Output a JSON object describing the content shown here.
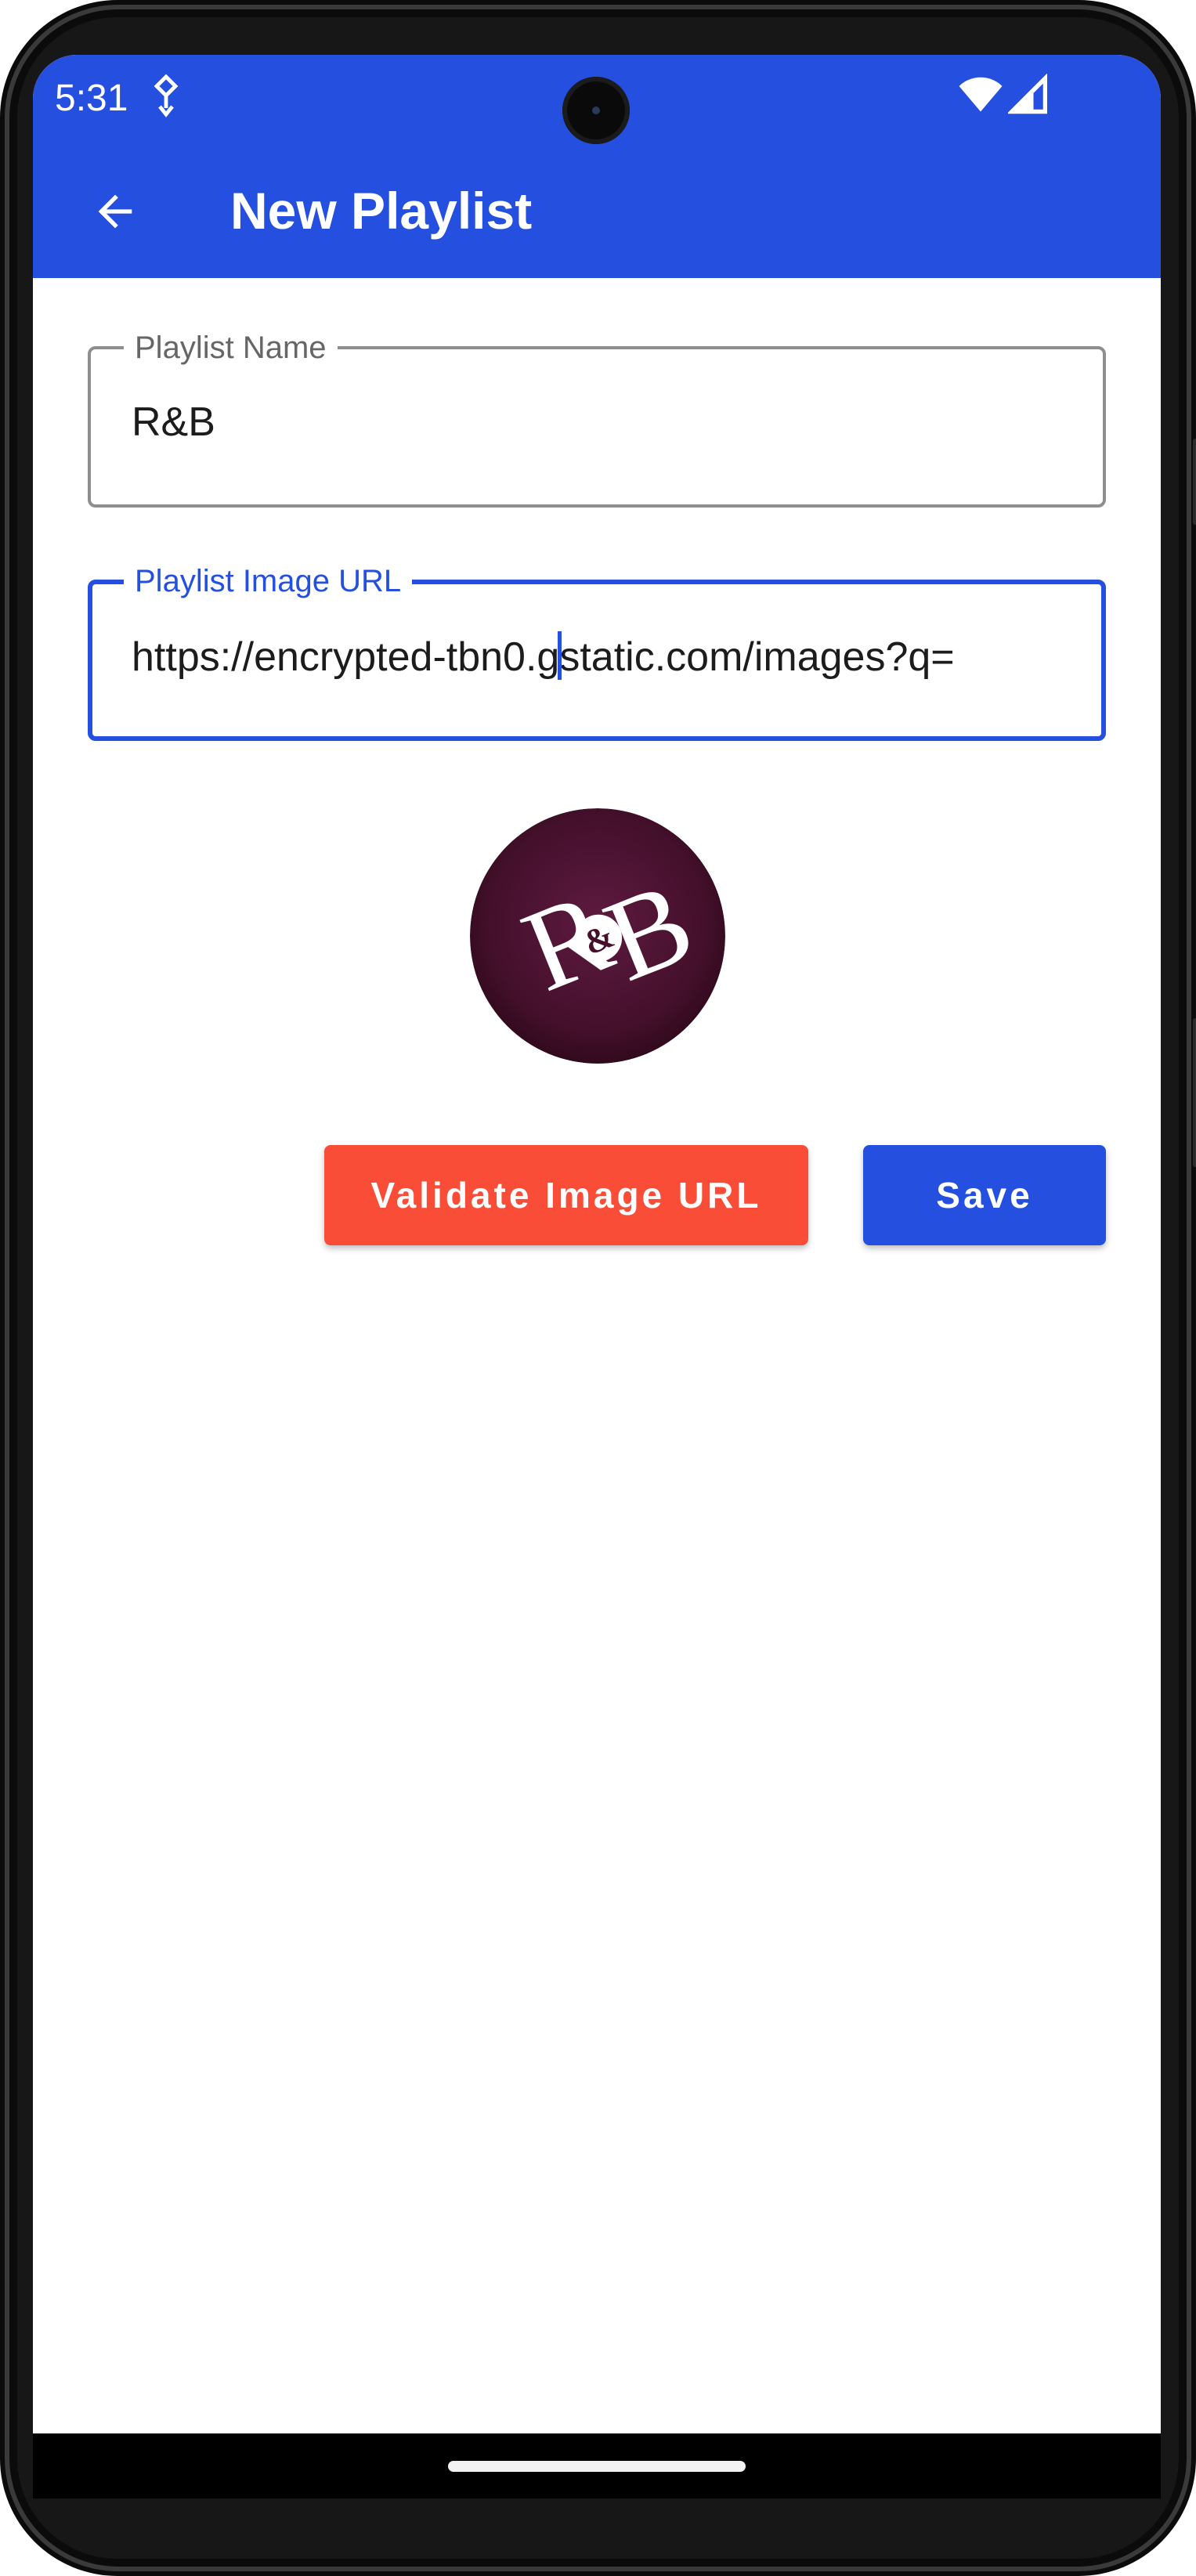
{
  "status_bar": {
    "time": "5:31",
    "notification_icon": "location-pin-icon",
    "wifi_icon": "wifi-icon",
    "signal_icon": "cell-signal-icon"
  },
  "app_bar": {
    "back_icon": "arrow-back-icon",
    "title": "New Playlist"
  },
  "form": {
    "name_label": "Playlist Name",
    "name_value": "R&B",
    "url_label": "Playlist Image URL",
    "url_value": "https://encrypted-tbn0.gstatic.com/images?q="
  },
  "preview": {
    "logo_text": "R&B"
  },
  "actions": {
    "validate_label": "Validate Image URL",
    "save_label": "Save"
  },
  "colors": {
    "primary": "#2550DF",
    "accent": "#FA4D38",
    "preview_bg": "#4A0E2E"
  }
}
